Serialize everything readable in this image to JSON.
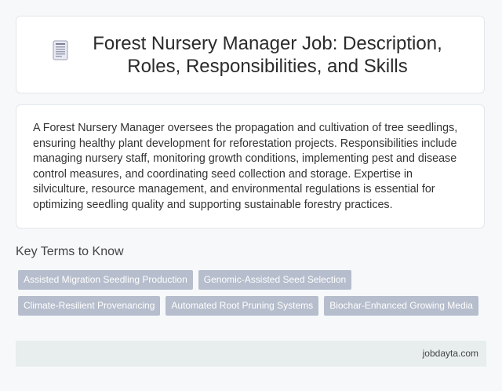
{
  "header": {
    "icon": "document-icon",
    "title": "Forest Nursery Manager Job: Description, Roles, Responsibilities, and Skills"
  },
  "description": {
    "text": "A Forest Nursery Manager oversees the propagation and cultivation of tree seedlings, ensuring healthy plant development for reforestation projects. Responsibilities include managing nursery staff, monitoring growth conditions, implementing pest and disease control measures, and coordinating seed collection and storage. Expertise in silviculture, resource management, and environmental regulations is essential for optimizing seedling quality and supporting sustainable forestry practices."
  },
  "key_terms": {
    "heading": "Key Terms to Know",
    "rows": [
      [
        "Assisted Migration Seedling Production",
        "Genomic-Assisted Seed Selection"
      ],
      [
        "Climate-Resilient Provenancing",
        "Automated Root Pruning Systems",
        "Biochar-Enhanced Growing Media"
      ]
    ]
  },
  "footer": {
    "site": "jobdayta.com"
  },
  "colors": {
    "page_bg": "#f6f8fa",
    "tag_bg": "#b6bdcc",
    "footer_bg": "#e8eeee"
  }
}
